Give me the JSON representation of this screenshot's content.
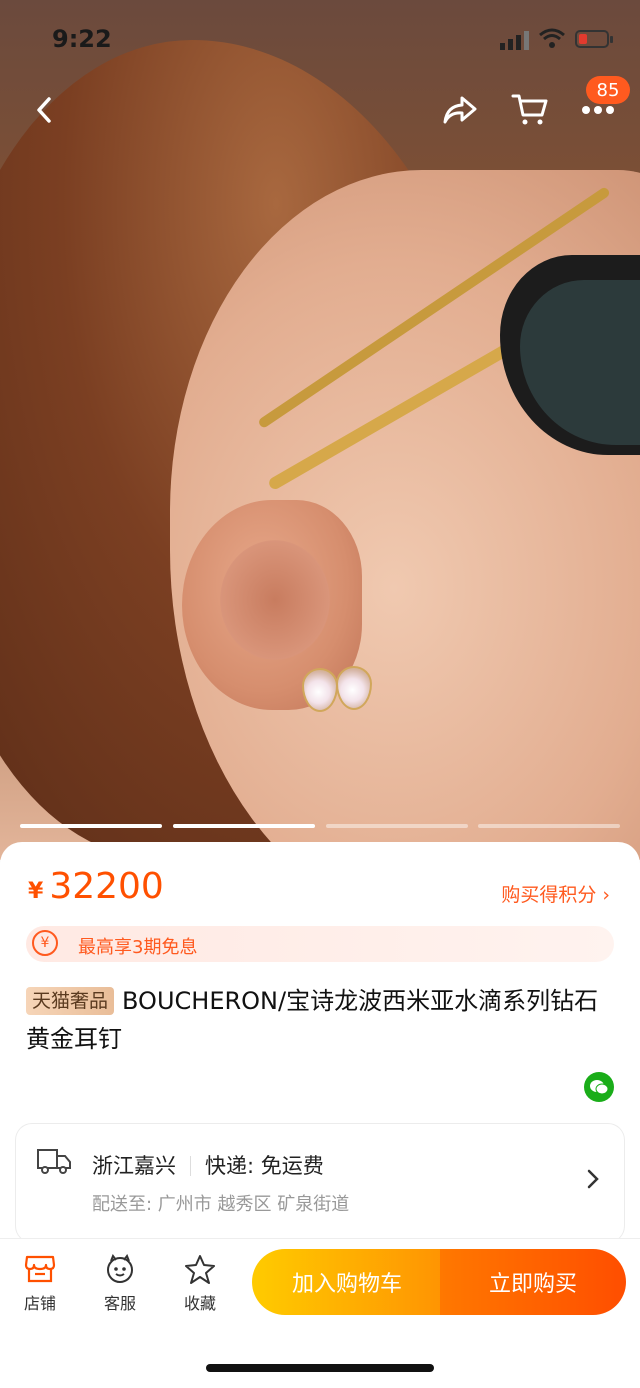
{
  "status_bar": {
    "time": "9:22"
  },
  "nav": {
    "badge_count": "85"
  },
  "gallery": {
    "image_count": 4,
    "active_index": 1
  },
  "product": {
    "currency_symbol": "¥",
    "price": "32200",
    "points_link": "购买得积分 ›",
    "promo": "最高享3期免息",
    "tag": "天猫奢品",
    "title": "BOUCHERON/宝诗龙波西米亚水滴系列钻石黄金耳钉"
  },
  "shipping": {
    "origin": "浙江嘉兴",
    "method": "快递: 免运费",
    "deliver_to": "配送至: 广州市 越秀区 矿泉街道"
  },
  "bottom_bar": {
    "store": "店铺",
    "service": "客服",
    "favorite": "收藏",
    "add_to_cart": "加入购物车",
    "buy_now": "立即购买"
  },
  "colors": {
    "accent": "#ff5000",
    "cart_gradient": [
      "#ffcb00",
      "#ff9402"
    ],
    "buy_gradient": [
      "#ff7800",
      "#ff4e00"
    ]
  }
}
